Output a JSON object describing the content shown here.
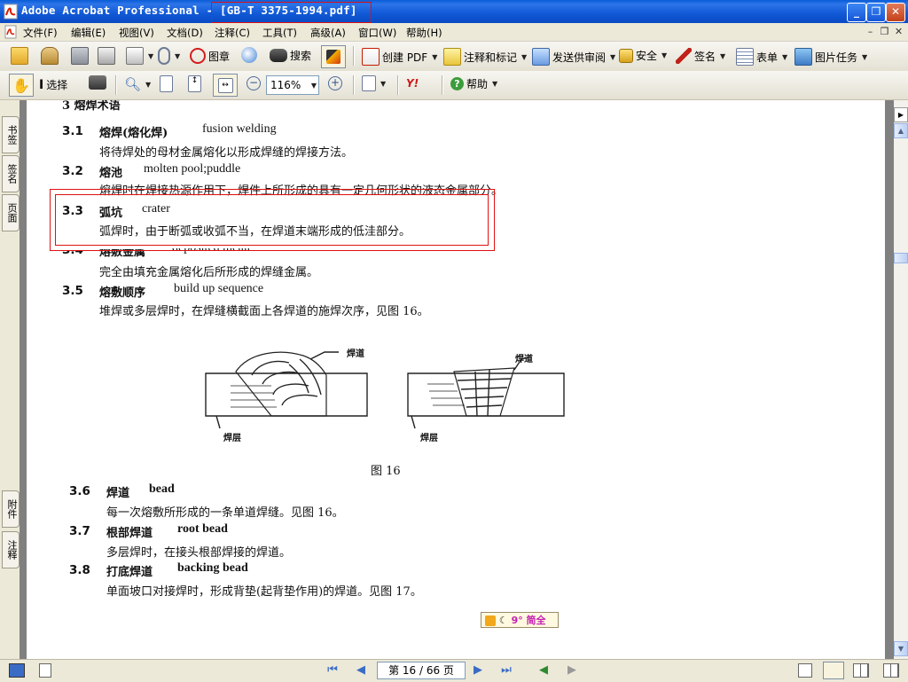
{
  "window": {
    "title": "Adobe Acrobat Professional - [GB-T 3375-1994.pdf]",
    "controls": [
      "_",
      "❐",
      "✕"
    ]
  },
  "menu": {
    "items": [
      "文件(F)",
      "编辑(E)",
      "视图(V)",
      "文档(D)",
      "注释(C)",
      "工具(T)",
      "高级(A)",
      "窗口(W)",
      "帮助(H)"
    ]
  },
  "toolbar1": {
    "stamp_label": "图章",
    "search_label": "搜索",
    "create_pdf_label": "创建 PDF",
    "comment_label": "注释和标记",
    "review_label": "发送供审阅",
    "security_label": "安全",
    "sign_label": "签名",
    "forms_label": "表单",
    "picture_label": "图片任务"
  },
  "toolbar2": {
    "select_label": "选择",
    "zoom_value": "116%",
    "help_label": "帮助"
  },
  "leftnav": {
    "tabs": [
      "书签",
      "签名",
      "页面"
    ],
    "bottom_tabs": [
      "附件",
      "注释"
    ]
  },
  "document": {
    "heading": "3  熔焊术语",
    "entries": [
      {
        "num": "3.1",
        "term": "熔焊(熔化焊)",
        "en": "fusion welding",
        "def": "将待焊处的母材金属熔化以形成焊缝的焊接方法。"
      },
      {
        "num": "3.2",
        "term": "熔池",
        "en": "molten pool;puddle",
        "def": "熔焊时在焊接热源作用下，焊件上所形成的具有一定几何形状的液态金属部分。"
      },
      {
        "num": "3.3",
        "term": "弧坑",
        "en": "crater",
        "def": "弧焊时，由于断弧或收弧不当，在焊道末端形成的低洼部分。"
      },
      {
        "num": "3.4",
        "term": "熔敷金属",
        "en": "deposited metal",
        "def": "完全由填充金属熔化后所形成的焊缝金属。"
      },
      {
        "num": "3.5",
        "term": "熔敷顺序",
        "en": "build up sequence",
        "def": "堆焊或多层焊时，在焊缝横截面上各焊道的施焊次序，见图 16。"
      },
      {
        "num": "3.6",
        "term": "焊道",
        "en": "bead",
        "def": "每一次熔敷所形成的一条单道焊缝。见图 16。"
      },
      {
        "num": "3.7",
        "term": "根部焊道",
        "en": "root bead",
        "def": "多层焊时，在接头根部焊接的焊道。"
      },
      {
        "num": "3.8",
        "term": "打底焊道",
        "en": "backing bead",
        "def": "单面坡口对接焊时，形成背垫(起背垫作用)的焊道。见图 17。"
      }
    ],
    "figure": {
      "caption": "图 16",
      "label_bead_left": "焊道",
      "label_bead_right": "焊道",
      "label_layer_left": "焊层",
      "label_layer_right": "焊层"
    },
    "ime_bar": "9° 简全"
  },
  "statusbar": {
    "page_indicator": "第 16 / 66 页"
  }
}
